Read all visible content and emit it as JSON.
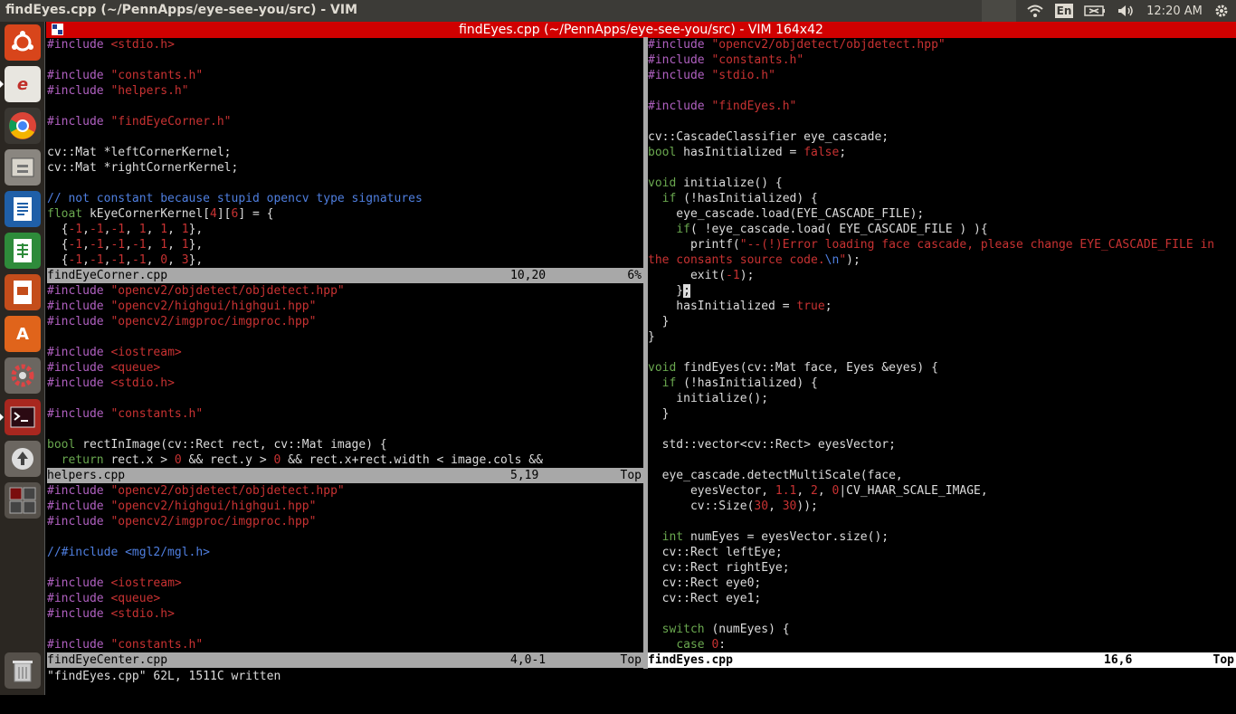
{
  "topbar": {
    "window_title": "findEyes.cpp (~/PennApps/eye-see-you/src) - VIM",
    "keyboard_layout": "En",
    "clock": "12:20 AM"
  },
  "launcher": {
    "items": [
      "dash-home",
      "text-editor",
      "chrome",
      "files",
      "libreoffice-writer",
      "libreoffice-calc",
      "libreoffice-impress",
      "software-center",
      "system-settings",
      "terminal",
      "software-updater",
      "workspace-switcher",
      "trash"
    ]
  },
  "vim": {
    "title": "findEyes.cpp (~/PennApps/eye-see-you/src) - VIM 164x42",
    "cmdline": "\"findEyes.cpp\" 62L, 1511C written",
    "windows": {
      "find_eye_corner": {
        "filename": "findEyeCorner.cpp",
        "position": "10,20",
        "scroll": "6%"
      },
      "helpers": {
        "filename": "helpers.cpp",
        "position": "5,19",
        "scroll": "Top"
      },
      "find_eye_center": {
        "filename": "findEyeCenter.cpp",
        "position": "4,0-1",
        "scroll": "Top"
      },
      "find_eyes": {
        "filename": "findEyes.cpp",
        "position": "16,6",
        "scroll": "Top"
      }
    }
  },
  "code": {
    "fec": [
      [
        [
          "pp",
          "#include "
        ],
        [
          "s",
          "<stdio.h>"
        ]
      ],
      [],
      [
        [
          "pp",
          "#include "
        ],
        [
          "s",
          "\"constants.h\""
        ]
      ],
      [
        [
          "pp",
          "#include "
        ],
        [
          "s",
          "\"helpers.h\""
        ]
      ],
      [],
      [
        [
          "pp",
          "#include "
        ],
        [
          "s",
          "\"findEyeCorner.h\""
        ]
      ],
      [],
      [
        [
          "",
          "cv::Mat *leftCornerKernel;"
        ]
      ],
      [
        [
          "",
          "cv::Mat *rightCornerKernel;"
        ]
      ],
      [],
      [
        [
          "c",
          "// not constant because stupid opencv type signatures"
        ]
      ],
      [
        [
          "k",
          "float"
        ],
        [
          "",
          " kEyeCornerKernel["
        ],
        [
          "n",
          "4"
        ],
        [
          "",
          "]["
        ],
        [
          "n",
          "6"
        ],
        [
          "",
          "] = {"
        ]
      ],
      [
        [
          "",
          "  {"
        ],
        [
          "n",
          "-1"
        ],
        [
          "",
          ","
        ],
        [
          "n",
          "-1"
        ],
        [
          "",
          ","
        ],
        [
          "n",
          "-1"
        ],
        [
          "",
          ", "
        ],
        [
          "n",
          "1"
        ],
        [
          "",
          ", "
        ],
        [
          "n",
          "1"
        ],
        [
          "",
          ", "
        ],
        [
          "n",
          "1"
        ],
        [
          "",
          "},"
        ]
      ],
      [
        [
          "",
          "  {"
        ],
        [
          "n",
          "-1"
        ],
        [
          "",
          ","
        ],
        [
          "n",
          "-1"
        ],
        [
          "",
          ","
        ],
        [
          "n",
          "-1"
        ],
        [
          "",
          ","
        ],
        [
          "n",
          "-1"
        ],
        [
          "",
          ", "
        ],
        [
          "n",
          "1"
        ],
        [
          "",
          ", "
        ],
        [
          "n",
          "1"
        ],
        [
          "",
          "},"
        ]
      ],
      [
        [
          "",
          "  {"
        ],
        [
          "n",
          "-1"
        ],
        [
          "",
          ","
        ],
        [
          "n",
          "-1"
        ],
        [
          "",
          ","
        ],
        [
          "n",
          "-1"
        ],
        [
          "",
          ","
        ],
        [
          "n",
          "-1"
        ],
        [
          "",
          ", "
        ],
        [
          "n",
          "0"
        ],
        [
          "",
          ", "
        ],
        [
          "n",
          "3"
        ],
        [
          "",
          "},"
        ]
      ]
    ],
    "helpers": [
      [
        [
          "pp",
          "#include "
        ],
        [
          "s",
          "\"opencv2/objdetect/objdetect.hpp\""
        ]
      ],
      [
        [
          "pp",
          "#include "
        ],
        [
          "s",
          "\"opencv2/highgui/highgui.hpp\""
        ]
      ],
      [
        [
          "pp",
          "#include "
        ],
        [
          "s",
          "\"opencv2/imgproc/imgproc.hpp\""
        ]
      ],
      [],
      [
        [
          "pp",
          "#include "
        ],
        [
          "s",
          "<iostream>"
        ]
      ],
      [
        [
          "pp",
          "#include "
        ],
        [
          "s",
          "<queue>"
        ]
      ],
      [
        [
          "pp",
          "#include "
        ],
        [
          "s",
          "<stdio.h>"
        ]
      ],
      [],
      [
        [
          "pp",
          "#include "
        ],
        [
          "s",
          "\"constants.h\""
        ]
      ],
      [],
      [
        [
          "k",
          "bool"
        ],
        [
          "",
          " rectInImage(cv::Rect rect, cv::Mat image) {"
        ]
      ],
      [
        [
          "",
          "  "
        ],
        [
          "k",
          "return"
        ],
        [
          "",
          " rect.x > "
        ],
        [
          "n",
          "0"
        ],
        [
          "",
          " && rect.y > "
        ],
        [
          "n",
          "0"
        ],
        [
          "",
          " && rect.x+rect.width < image.cols &&"
        ]
      ]
    ],
    "center": [
      [
        [
          "pp",
          "#include "
        ],
        [
          "s",
          "\"opencv2/objdetect/objdetect.hpp\""
        ]
      ],
      [
        [
          "pp",
          "#include "
        ],
        [
          "s",
          "\"opencv2/highgui/highgui.hpp\""
        ]
      ],
      [
        [
          "pp",
          "#include "
        ],
        [
          "s",
          "\"opencv2/imgproc/imgproc.hpp\""
        ]
      ],
      [],
      [
        [
          "c",
          "//#include <mgl2/mgl.h>"
        ]
      ],
      [],
      [
        [
          "pp",
          "#include "
        ],
        [
          "s",
          "<iostream>"
        ]
      ],
      [
        [
          "pp",
          "#include "
        ],
        [
          "s",
          "<queue>"
        ]
      ],
      [
        [
          "pp",
          "#include "
        ],
        [
          "s",
          "<stdio.h>"
        ]
      ],
      [],
      [
        [
          "pp",
          "#include "
        ],
        [
          "s",
          "\"constants.h\""
        ]
      ]
    ],
    "eyes": [
      [
        [
          "pp",
          "#include "
        ],
        [
          "s",
          "\"opencv2/objdetect/objdetect.hpp\""
        ]
      ],
      [
        [
          "pp",
          "#include "
        ],
        [
          "s",
          "\"constants.h\""
        ]
      ],
      [
        [
          "pp",
          "#include "
        ],
        [
          "s",
          "\"stdio.h\""
        ]
      ],
      [],
      [
        [
          "pp",
          "#include "
        ],
        [
          "s",
          "\"findEyes.h\""
        ]
      ],
      [],
      [
        [
          "",
          "cv::CascadeClassifier eye_cascade;"
        ]
      ],
      [
        [
          "k",
          "bool"
        ],
        [
          "",
          " hasInitialized = "
        ],
        [
          "n",
          "false"
        ],
        [
          "",
          ";"
        ]
      ],
      [],
      [
        [
          "k",
          "void"
        ],
        [
          "",
          " initialize() {"
        ]
      ],
      [
        [
          "",
          "  "
        ],
        [
          "k",
          "if"
        ],
        [
          "",
          " (!hasInitialized) {"
        ]
      ],
      [
        [
          "",
          "    eye_cascade.load(EYE_CASCADE_FILE);"
        ]
      ],
      [
        [
          "",
          "    "
        ],
        [
          "k",
          "if"
        ],
        [
          "",
          "( !eye_cascade.load( EYE_CASCADE_FILE ) ){"
        ]
      ],
      [
        [
          "",
          "      printf("
        ],
        [
          "s",
          "\"--(!)Error loading face cascade, please change EYE_CASCADE_FILE in"
        ]
      ],
      [
        [
          "s",
          "the consants source code."
        ],
        [
          "c",
          "\\n"
        ],
        [
          "s",
          "\""
        ],
        [
          "",
          ");"
        ]
      ],
      [
        [
          "",
          "      exit("
        ],
        [
          "n",
          "-1"
        ],
        [
          "",
          ");"
        ]
      ],
      [
        [
          "",
          "    }"
        ],
        [
          "cursor",
          ";"
        ]
      ],
      [
        [
          "",
          "    hasInitialized = "
        ],
        [
          "n",
          "true"
        ],
        [
          "",
          ";"
        ]
      ],
      [
        [
          "",
          "  }"
        ]
      ],
      [
        [
          "",
          "}"
        ]
      ],
      [],
      [
        [
          "k",
          "void"
        ],
        [
          "",
          " findEyes(cv::Mat face, Eyes &eyes) {"
        ]
      ],
      [
        [
          "",
          "  "
        ],
        [
          "k",
          "if"
        ],
        [
          "",
          " (!hasInitialized) {"
        ]
      ],
      [
        [
          "",
          "    initialize();"
        ]
      ],
      [
        [
          "",
          "  }"
        ]
      ],
      [],
      [
        [
          "",
          "  std::vector<cv::Rect> eyesVector;"
        ]
      ],
      [],
      [
        [
          "",
          "  eye_cascade.detectMultiScale(face,"
        ]
      ],
      [
        [
          "",
          "      eyesVector, "
        ],
        [
          "n",
          "1.1"
        ],
        [
          "",
          ", "
        ],
        [
          "n",
          "2"
        ],
        [
          "",
          ", "
        ],
        [
          "n",
          "0"
        ],
        [
          "",
          "|CV_HAAR_SCALE_IMAGE,"
        ]
      ],
      [
        [
          "",
          "      cv::Size("
        ],
        [
          "n",
          "30"
        ],
        [
          "",
          ", "
        ],
        [
          "n",
          "30"
        ],
        [
          "",
          "));"
        ]
      ],
      [],
      [
        [
          "",
          "  "
        ],
        [
          "k",
          "int"
        ],
        [
          "",
          " numEyes = eyesVector.size();"
        ]
      ],
      [
        [
          "",
          "  cv::Rect leftEye;"
        ]
      ],
      [
        [
          "",
          "  cv::Rect rightEye;"
        ]
      ],
      [
        [
          "",
          "  cv::Rect eye0;"
        ]
      ],
      [
        [
          "",
          "  cv::Rect eye1;"
        ]
      ],
      [],
      [
        [
          "",
          "  "
        ],
        [
          "k",
          "switch"
        ],
        [
          "",
          " (numEyes) {"
        ]
      ],
      [
        [
          "",
          "    "
        ],
        [
          "k",
          "case"
        ],
        [
          "",
          " "
        ],
        [
          "n",
          "0"
        ],
        [
          "",
          ":"
        ]
      ]
    ]
  }
}
